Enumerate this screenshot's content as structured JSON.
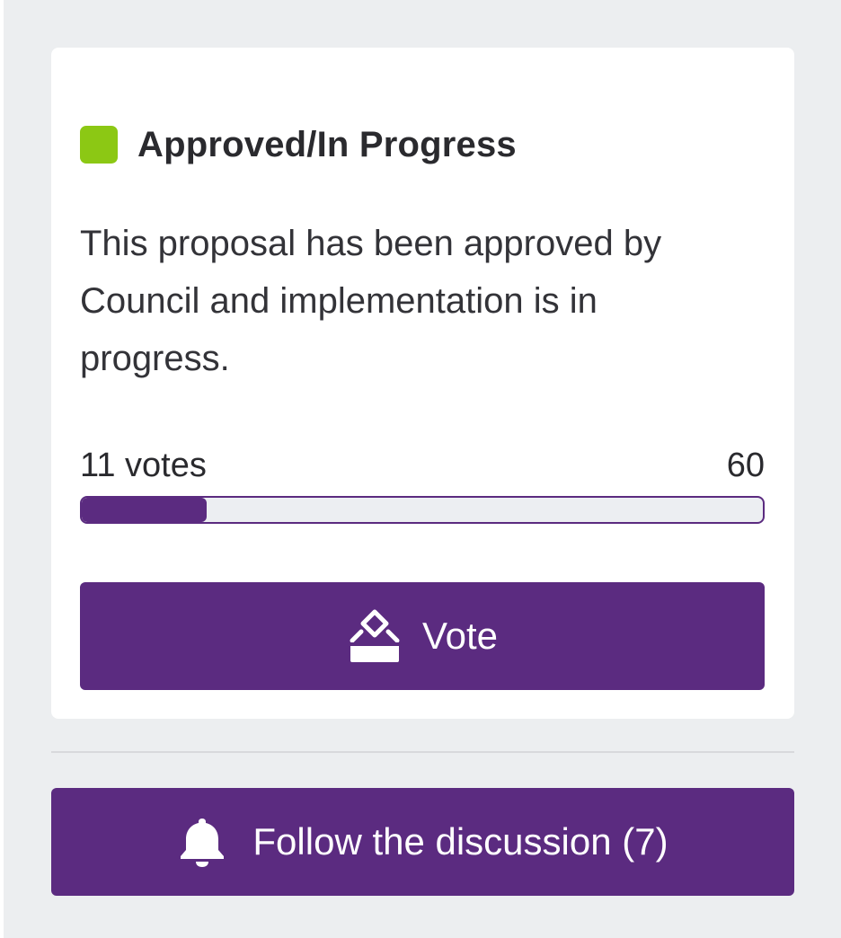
{
  "status": {
    "title": "Approved/In Progress",
    "description": "This proposal has been approved by Council and implementation is in progress.",
    "color": "#8cc814"
  },
  "votes": {
    "count_label": "11 votes",
    "goal": "60",
    "progress_fraction": 0.1833
  },
  "vote_button": {
    "label": "Vote",
    "icon": "ballot-box-icon"
  },
  "follow_button": {
    "label": "Follow the discussion (7)",
    "icon": "bell-icon"
  },
  "colors": {
    "accent": "#5b2b80",
    "page_background": "#eceef0",
    "card_background": "#ffffff"
  }
}
